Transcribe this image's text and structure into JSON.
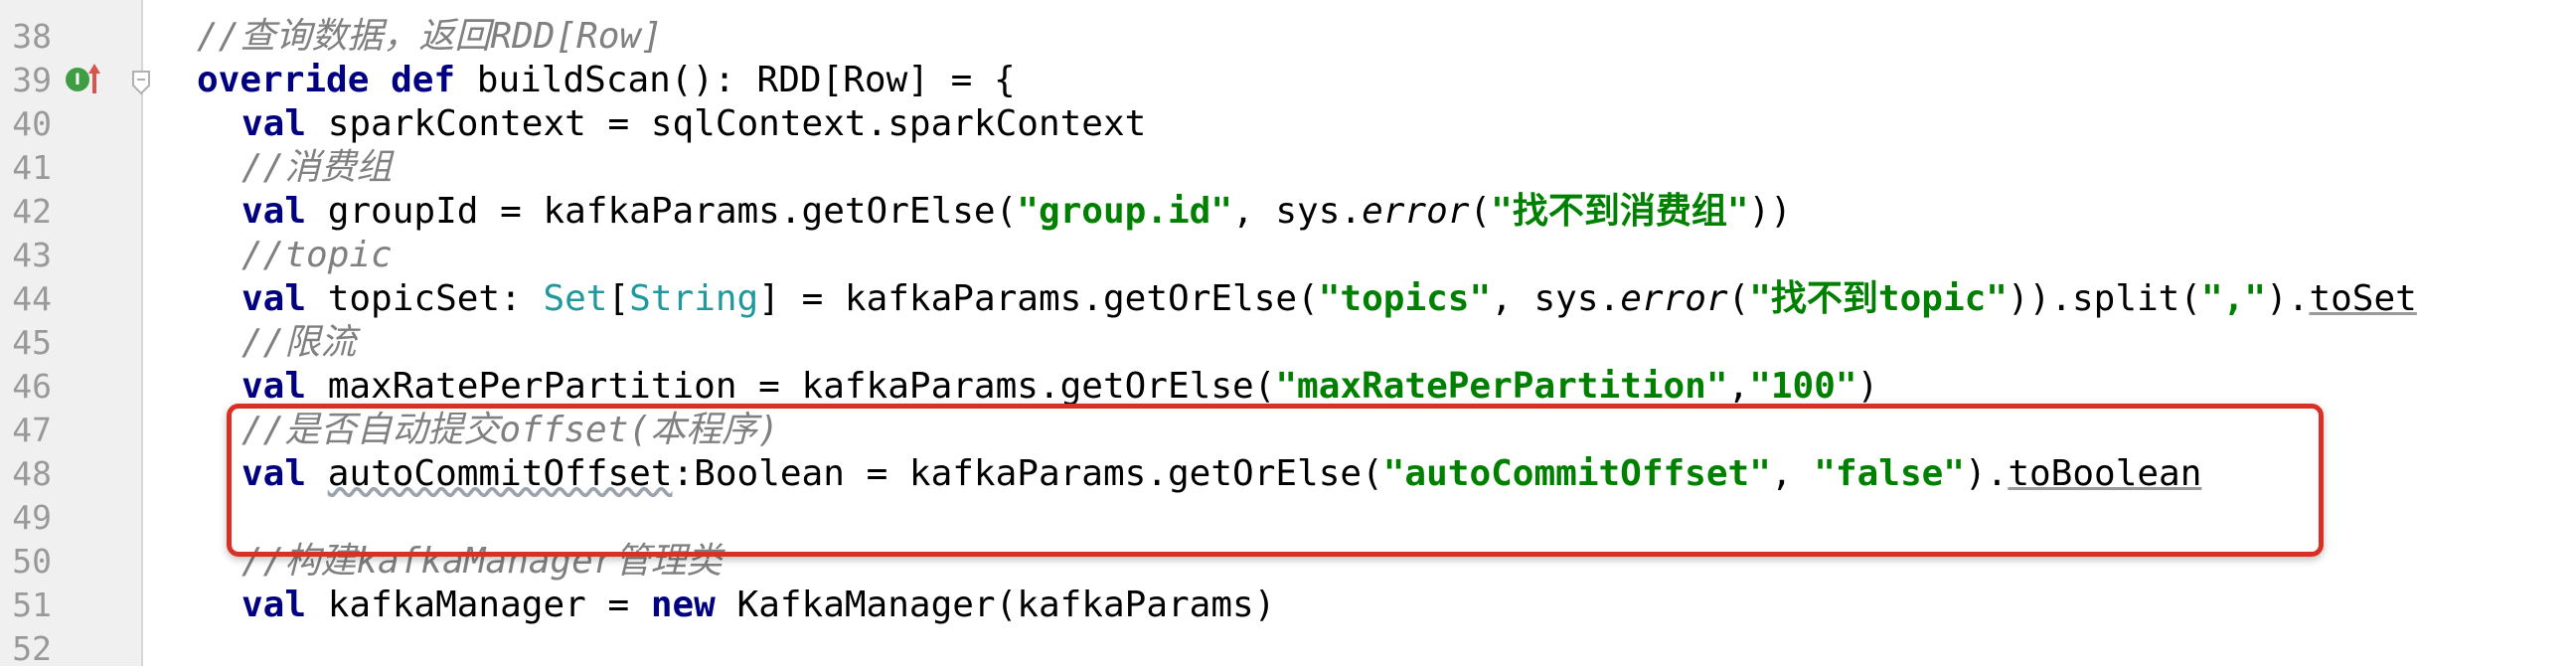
{
  "gutter": {
    "line_numbers": [
      "38",
      "39",
      "40",
      "41",
      "42",
      "43",
      "44",
      "45",
      "46",
      "47",
      "48",
      "49",
      "50",
      "51",
      "52"
    ]
  },
  "code": {
    "l38": {
      "comment": "//查询数据，返回",
      "comment_it": "RDD[Row]"
    },
    "l39": {
      "kw1": "override",
      "kw2": "def",
      "rest": " buildScan(): RDD[Row] = {"
    },
    "l40": {
      "kw": "val",
      "rest": " sparkContext = sqlContext.sparkContext"
    },
    "l41": {
      "comment": "//消费组"
    },
    "l42": {
      "kw": "val",
      "a": " groupId = kafkaParams.getOrElse(",
      "s1": "\"group.id\"",
      "b": ", sys.",
      "err": "error",
      "c": "(",
      "s2": "\"找不到消费组\"",
      "d": "))"
    },
    "l43": {
      "comment": "//topic"
    },
    "l44": {
      "kw": "val",
      "a": " topicSet: ",
      "t1": "Set",
      "b": "[",
      "t2": "String",
      "c": "] = kafkaParams.getOrElse(",
      "s1": "\"topics\"",
      "d": ", sys.",
      "err": "error",
      "e": "(",
      "s2": "\"找不到topic\"",
      "f": ")).split(",
      "s3": "\",\"",
      "g": ").",
      "u": "toSet"
    },
    "l45": {
      "comment": "//限流"
    },
    "l46": {
      "kw": "val",
      "a": " maxRatePerPartition = kafkaParams.getOrElse(",
      "s1": "\"maxRatePerPartition\"",
      "b": ",",
      "s2": "\"100\"",
      "c": ")"
    },
    "l47": {
      "comment": "//是否自动提交",
      "comment_it": "offset(",
      "comment2": "本程序",
      "comment3": ")"
    },
    "l48": {
      "kw": "val",
      "a": " ",
      "w": "autoCommitOffset",
      "b": ":Boolean = kafkaParams.getOrElse(",
      "s1": "\"autoCommitOffset\"",
      "c": ", ",
      "s2": "\"false\"",
      "d": ").",
      "u": "toBoolean"
    },
    "l50": {
      "comment": "//构建",
      "comment_it": "kafkaManager",
      "comment2": "管理类"
    },
    "l51": {
      "kw": "val",
      "a": " kafkaManager = ",
      "kw2": "new",
      "b": " KafkaManager(kafkaParams)"
    }
  },
  "icons": {
    "implements": "implements-indicator-icon",
    "override_arrow": "override-up-arrow-icon",
    "fold": "fold-marker-icon"
  },
  "colors": {
    "keyword": "#000080",
    "string": "#008000",
    "comment": "#808080",
    "type": "#20999d",
    "highlight_box": "#d93025"
  }
}
